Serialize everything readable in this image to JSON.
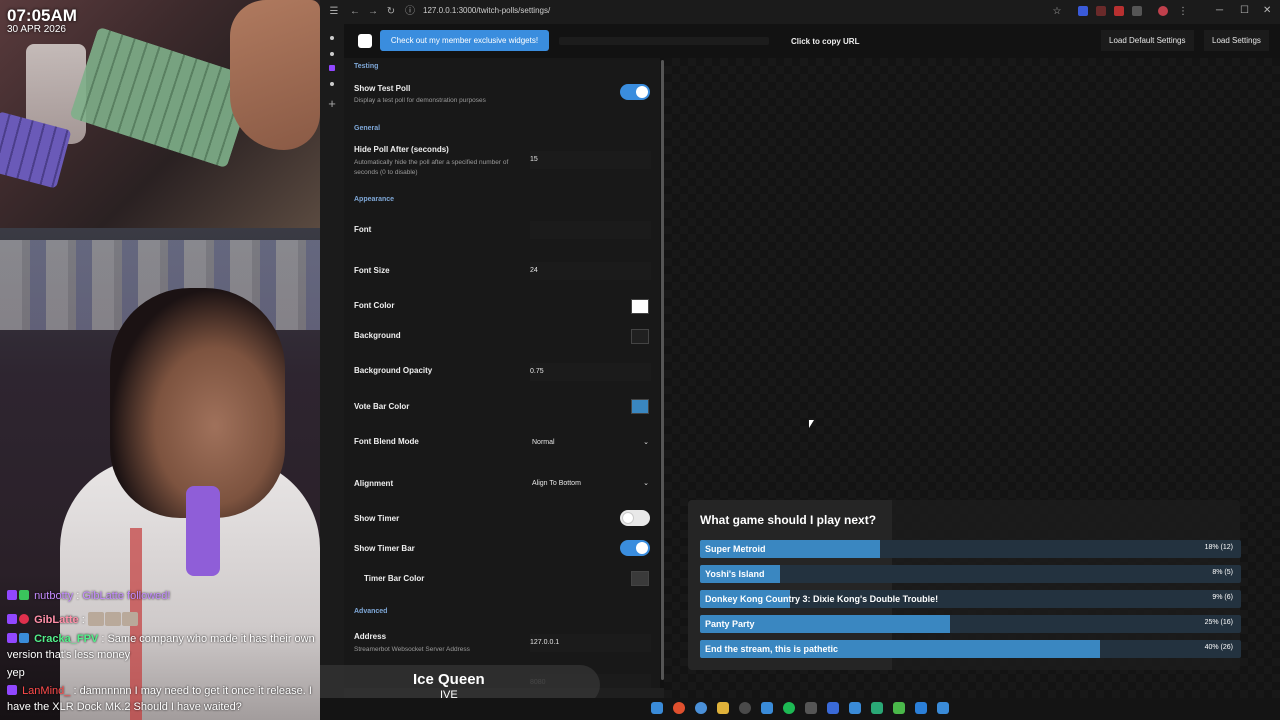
{
  "overlay": {
    "time": "07:05AM",
    "date": "30 APR 2026"
  },
  "chat": [
    {
      "user": "nutbotty",
      "message": "GibLatte followed!"
    },
    {
      "user": "GibLatte",
      "message": ""
    },
    {
      "user": "Cracka_FPV",
      "message": "Same company who made it has their own version that's less money"
    },
    {
      "user": "",
      "message": "yep"
    },
    {
      "user": "LanMind_",
      "message": "damnnnnn I may need to get it once it release. I have the XLR Dock MK.2 Should I have waited?"
    }
  ],
  "now_playing": {
    "title": "Ice Queen",
    "subtitle": "IVE"
  },
  "browser": {
    "url": "127.0.0.1:3000/twitch-polls/settings/"
  },
  "appbar": {
    "promo": "Check out my member exclusive widgets!",
    "copy_url": "Click to copy URL",
    "load_default": "Load Default Settings",
    "load_settings": "Load Settings"
  },
  "settings": {
    "testing": {
      "section": "Testing",
      "show_test_poll": "Show Test Poll",
      "show_test_poll_desc": "Display a test poll for demonstration purposes"
    },
    "general": {
      "section": "General",
      "hide_poll_after": "Hide Poll After (seconds)",
      "hide_poll_after_desc": "Automatically hide the poll after a specified number of seconds (0 to disable)",
      "hide_poll_after_value": "15"
    },
    "appearance": {
      "section": "Appearance",
      "font": "Font",
      "font_value": "",
      "font_size": "Font Size",
      "font_size_value": "24",
      "font_color": "Font Color",
      "background": "Background",
      "background_opacity": "Background Opacity",
      "background_opacity_value": "0.75",
      "vote_bar_color": "Vote Bar Color",
      "font_blend_mode": "Font Blend Mode",
      "font_blend_mode_value": "Normal",
      "alignment": "Alignment",
      "alignment_value": "Align To Bottom",
      "show_timer": "Show Timer",
      "show_timer_bar": "Show Timer Bar",
      "timer_bar_color": "Timer Bar Color"
    },
    "advanced": {
      "section": "Advanced",
      "address": "Address",
      "address_desc": "Streamerbot Websocket Server Address",
      "address_value": "127.0.0.1",
      "port_value": "8080"
    },
    "toggles": {
      "show_test_poll": true,
      "show_timer": false,
      "show_timer_bar": true
    },
    "colors": {
      "font_color": "#ffffff",
      "background": "#202020",
      "vote_bar_color": "#3a87c1",
      "timer_bar_color": "#3a3a3a"
    }
  },
  "poll": {
    "question": "What game should I play next?",
    "options": [
      {
        "label": "Super Metroid",
        "percent": 18,
        "votes": 12,
        "pct_text": "18% (12)"
      },
      {
        "label": "Yoshi's Island",
        "percent": 8,
        "votes": 5,
        "pct_text": "8% (5)"
      },
      {
        "label": "Donkey Kong Country 3: Dixie Kong's Double Trouble!",
        "percent": 9,
        "votes": 6,
        "pct_text": "9% (6)"
      },
      {
        "label": "Panty Party",
        "percent": 25,
        "votes": 16,
        "pct_text": "25% (16)"
      },
      {
        "label": "End the stream, this is pathetic",
        "percent": 40,
        "votes": 26,
        "pct_text": "40% (26)"
      }
    ],
    "colors": {
      "bar": "#3a87c1",
      "track": "#23323f"
    }
  }
}
